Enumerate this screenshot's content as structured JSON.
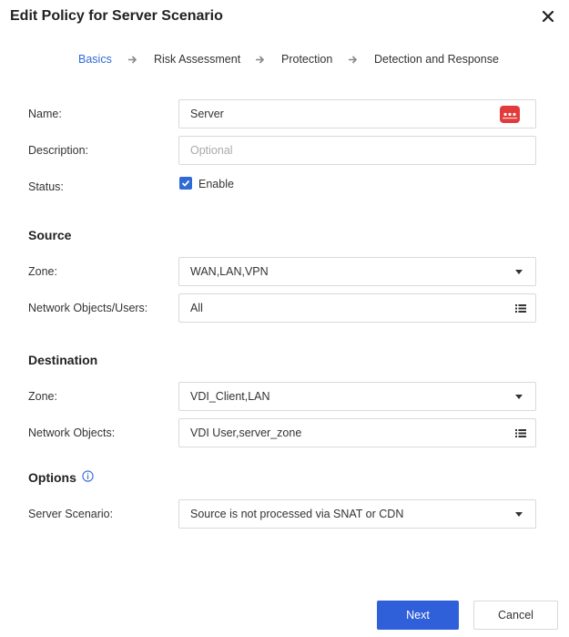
{
  "dialog": {
    "title": "Edit Policy for Server Scenario"
  },
  "steps": [
    {
      "label": "Basics",
      "active": true
    },
    {
      "label": "Risk Assessment",
      "active": false
    },
    {
      "label": "Protection",
      "active": false
    },
    {
      "label": "Detection and Response",
      "active": false
    }
  ],
  "basics": {
    "name_label": "Name:",
    "name_value": "Server",
    "description_label": "Description:",
    "description_placeholder": "Optional",
    "status_label": "Status:",
    "status_checkbox_label": "Enable",
    "status_checked": true
  },
  "source": {
    "heading": "Source",
    "zone_label": "Zone:",
    "zone_value": "WAN,LAN,VPN",
    "objects_label": "Network Objects/Users:",
    "objects_value": "All"
  },
  "destination": {
    "heading": "Destination",
    "zone_label": "Zone:",
    "zone_value": "VDI_Client,LAN",
    "objects_label": "Network Objects:",
    "objects_value": "VDI User,server_zone"
  },
  "options": {
    "heading": "Options",
    "server_scenario_label": "Server Scenario:",
    "server_scenario_value": "Source is not processed via SNAT or CDN"
  },
  "footer": {
    "next_label": "Next",
    "cancel_label": "Cancel"
  },
  "colors": {
    "accent": "#2f6bd6",
    "primary_button": "#2f5fd9",
    "password_badge": "#e33b3b"
  },
  "icons": [
    "close-icon",
    "arrow-right-icon",
    "password-manager-icon",
    "chevron-down-icon",
    "list-icon",
    "checkmark-icon",
    "info-icon"
  ]
}
